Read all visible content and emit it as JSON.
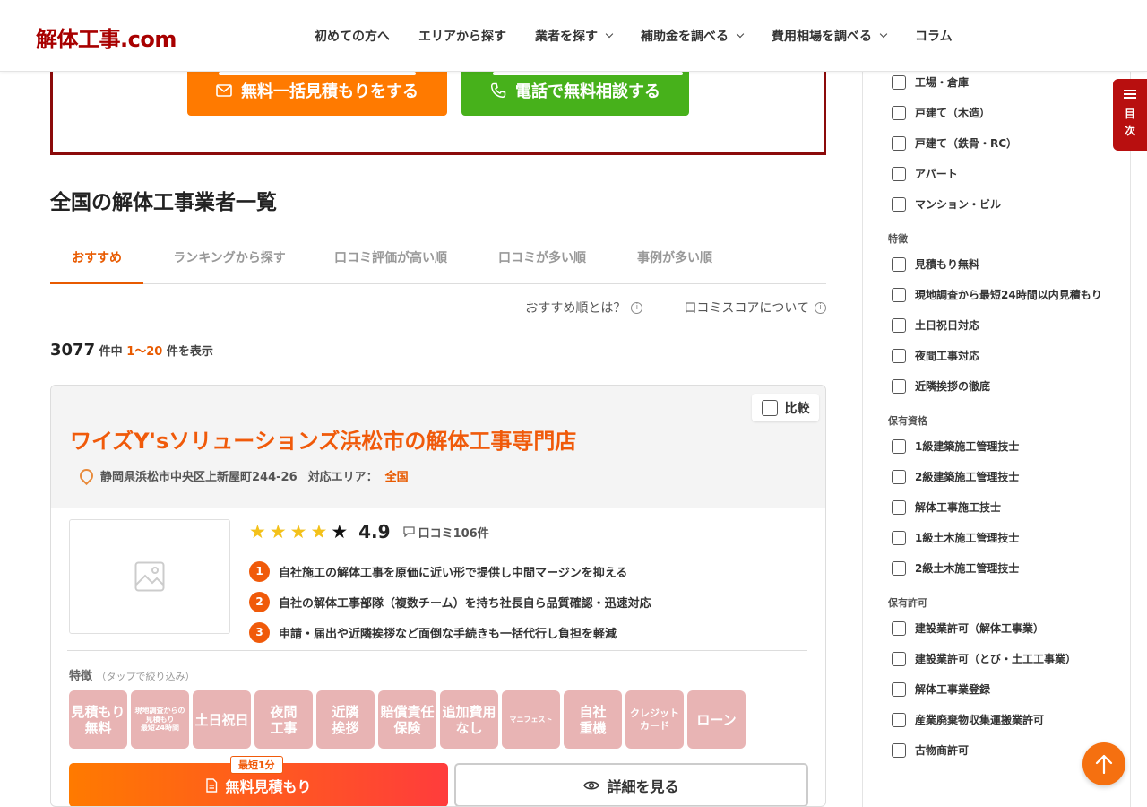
{
  "header": {
    "logo": "解体工事.com",
    "nav": [
      {
        "label": "初めての方へ",
        "dropdown": false
      },
      {
        "label": "エリアから探す",
        "dropdown": false
      },
      {
        "label": "業者を探す",
        "dropdown": true
      },
      {
        "label": "補助金を調べる",
        "dropdown": true
      },
      {
        "label": "費用相場を調べる",
        "dropdown": true
      },
      {
        "label": "コラム",
        "dropdown": false
      }
    ]
  },
  "cta": {
    "estimate_label": "無料一括見積もりをする",
    "phone_label": "電話で無料相談する"
  },
  "main": {
    "title": "全国の解体工事業者一覧",
    "tabs": [
      {
        "label": "おすすめ",
        "active": true
      },
      {
        "label": "ランキングから探す",
        "active": false
      },
      {
        "label": "口コミ評価が高い順",
        "active": false
      },
      {
        "label": "口コミが多い順",
        "active": false
      },
      {
        "label": "事例が多い順",
        "active": false
      }
    ],
    "help": [
      "おすすめ順とは？",
      "口コミスコアについて"
    ],
    "count": {
      "total": "3077",
      "mid": "件中",
      "range": "1〜20",
      "suffix": "件を表示"
    }
  },
  "card": {
    "compare_label": "比較",
    "name": "ワイズY'sソリューションズ浜松市の解体工事専門店",
    "address": "静岡県浜松市中央区上新屋町244-26",
    "area_label": "対応エリア：",
    "area_value": "全国",
    "stars": 4,
    "score": "4.9",
    "reviews": "口コミ106件",
    "points": [
      "自社施工の解体工事を原価に近い形で提供し中間マージンを抑える",
      "自社の解体工事部隊（複数チーム）を持ち社長自ら品質確認・迅速対応",
      "申請・届出や近隣挨拶など面倒な手続きも一括代行し負担を軽減"
    ],
    "features_label": "特徴",
    "features_hint": "（タップで絞り込み）",
    "features": [
      {
        "text": "見積もり\n無料",
        "size": "normal"
      },
      {
        "text": "現地調査からの\n見積もり\n最短24時間",
        "size": "small"
      },
      {
        "text": "土日祝日",
        "size": "normal"
      },
      {
        "text": "夜間\n工事",
        "size": "normal"
      },
      {
        "text": "近隣\n挨拶",
        "size": "normal"
      },
      {
        "text": "賠償責任\n保険",
        "size": "normal"
      },
      {
        "text": "追加費用\nなし",
        "size": "normal"
      },
      {
        "text": "マニフェスト",
        "size": "small"
      },
      {
        "text": "自社\n重機",
        "size": "normal"
      },
      {
        "text": "クレジット\nカード",
        "size": "med"
      },
      {
        "text": "ローン",
        "size": "normal"
      }
    ],
    "estimate_badge": "最短1分",
    "estimate_label": "無料見積もり",
    "detail_label": "詳細を見る"
  },
  "sidebar": {
    "top_items": [
      "工場・倉庫",
      "戸建て（木造）",
      "戸建て（鉄骨・RC）",
      "アパート",
      "マンション・ビル"
    ],
    "groups": [
      {
        "label": "特徴",
        "items": [
          "見積もり無料",
          "現地調査から最短24時間以内見積もり",
          "土日祝日対応",
          "夜間工事対応",
          "近隣挨拶の徹底"
        ]
      },
      {
        "label": "保有資格",
        "items": [
          "1級建築施工管理技士",
          "2級建築施工管理技士",
          "解体工事施工技士",
          "1級土木施工管理技士",
          "2級土木施工管理技士"
        ]
      },
      {
        "label": "保有許可",
        "items": [
          "建設業許可（解体工事業）",
          "建設業許可（とび・土工工事業）",
          "解体工事業登録",
          "産業廃棄物収集運搬業許可",
          "古物商許可"
        ]
      }
    ]
  },
  "toc": {
    "line1": "目",
    "line2": "次"
  },
  "colors": {
    "brand": "#a80000",
    "accent": "#f05a0a",
    "green": "#47b11b",
    "chip": "#e8b4b4"
  }
}
